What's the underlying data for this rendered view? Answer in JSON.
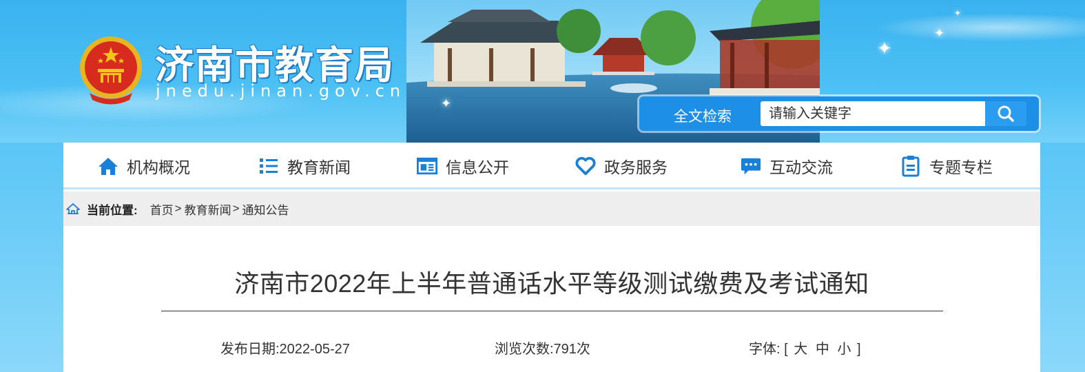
{
  "header": {
    "site_title": "济南市教育局",
    "site_url": "jnedu.jinan.gov.cn"
  },
  "search": {
    "label": "全文检索",
    "placeholder": "请输入关键字",
    "button_icon": "search-icon"
  },
  "nav": {
    "items": [
      {
        "label": "机构概况",
        "icon": "home-icon"
      },
      {
        "label": "教育新闻",
        "icon": "list-icon"
      },
      {
        "label": "信息公开",
        "icon": "newspaper-icon"
      },
      {
        "label": "政务服务",
        "icon": "heart-icon"
      },
      {
        "label": "互动交流",
        "icon": "chat-bubble-icon"
      },
      {
        "label": "专题专栏",
        "icon": "clipboard-icon"
      }
    ]
  },
  "breadcrumb": {
    "label": "当前位置:",
    "items": [
      "首页",
      "教育新闻",
      "通知公告"
    ],
    "separator": ">"
  },
  "article": {
    "title": "济南市2022年上半年普通话水平等级测试缴费及考试通知",
    "publish_date": "发布日期:2022-05-27",
    "views": "浏览次数:791次",
    "font_size_label": "字体:",
    "font_size_open": "[",
    "font_size_large": "大",
    "font_size_medium": "中",
    "font_size_small": "小",
    "font_size_close": "]"
  },
  "colors": {
    "banner_blue": "#3fb7f2",
    "search_blue": "#1e8fe6",
    "nav_icon_blue": "#1a7fd6",
    "text_dark": "#333333"
  }
}
